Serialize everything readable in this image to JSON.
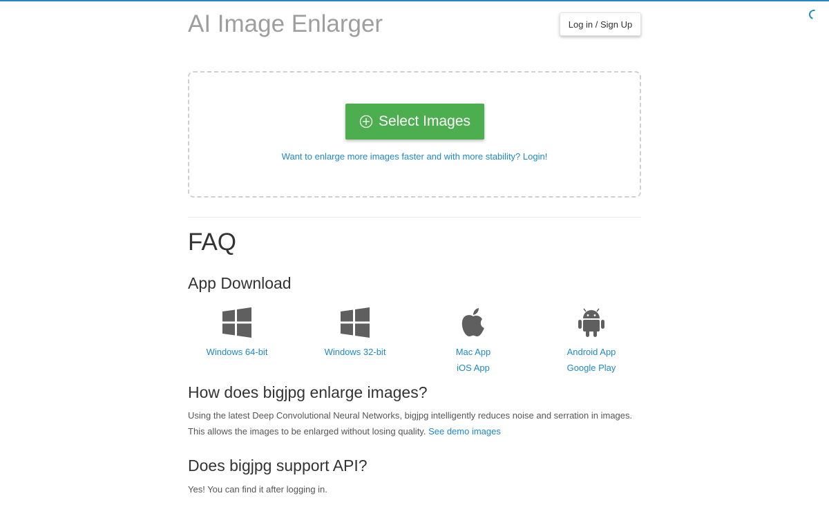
{
  "header": {
    "title": "AI Image Enlarger",
    "login_label": "Log in / Sign Up"
  },
  "upload": {
    "select_label": "Select Images",
    "login_hint": "Want to enlarge more images faster and with more stability? Login!"
  },
  "faq": {
    "title": "FAQ",
    "app_download": {
      "heading": "App Download",
      "apps": [
        {
          "icon": "windows-icon",
          "links": [
            "Windows 64-bit"
          ]
        },
        {
          "icon": "windows-icon",
          "links": [
            "Windows 32-bit"
          ]
        },
        {
          "icon": "apple-icon",
          "links": [
            "Mac App",
            "iOS App"
          ]
        },
        {
          "icon": "android-icon",
          "links": [
            "Android App",
            "Google Play"
          ]
        }
      ]
    },
    "how": {
      "heading": "How does bigjpg enlarge images?",
      "answer": "Using the latest Deep Convolutional Neural Networks, bigjpg intelligently reduces noise and serration in images. This allows the images to be enlarged without losing quality.",
      "link": "See demo images"
    },
    "api": {
      "heading": "Does bigjpg support API?",
      "answer": "Yes! You can find it after logging in."
    }
  },
  "colors": {
    "accent": "#1e88c9",
    "select_button": "#4cae4f",
    "title": "#9e9e9e"
  }
}
